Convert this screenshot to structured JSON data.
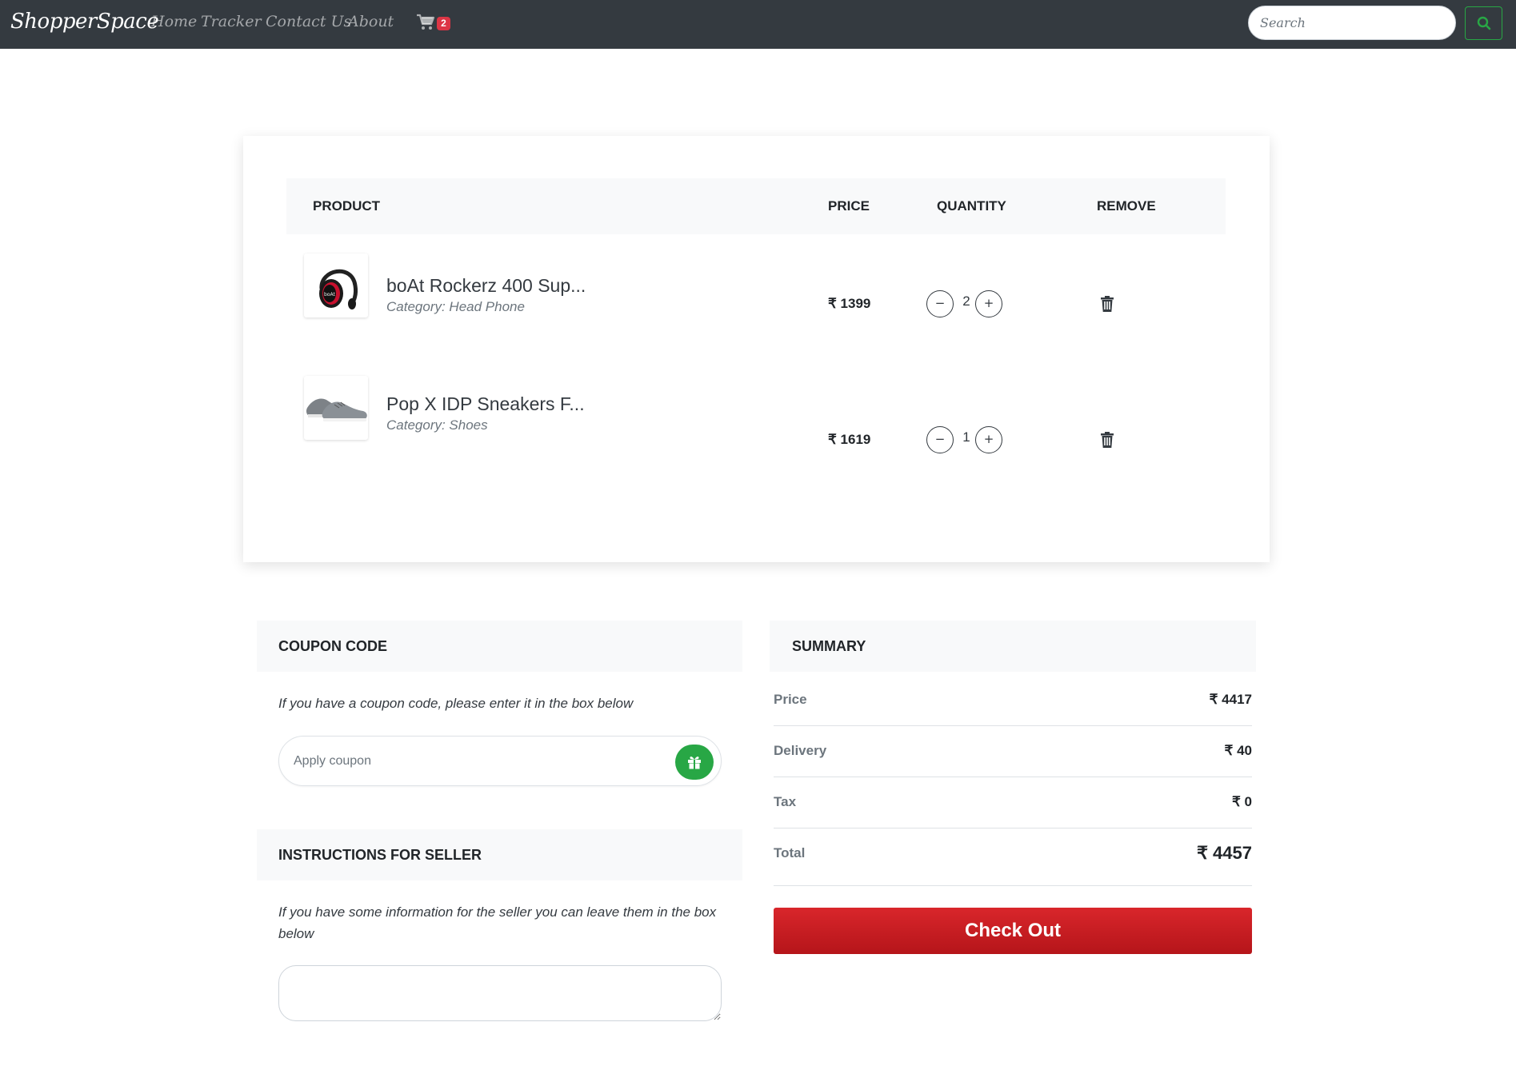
{
  "navbar": {
    "brand": "ShopperSpace",
    "links": [
      "Home",
      "Tracker",
      "Contact Us",
      "About"
    ],
    "cart_count": "2",
    "search_placeholder": "Search"
  },
  "cart": {
    "headers": {
      "product": "PRODUCT",
      "price": "PRICE",
      "quantity": "QUANTITY",
      "remove": "REMOVE"
    },
    "items": [
      {
        "name": "boAt Rockerz 400 Sup...",
        "category": "Category: Head Phone",
        "price": "₹ 1399",
        "quantity": "2",
        "image": "headphone-image"
      },
      {
        "name": "Pop X IDP Sneakers F...",
        "category": "Category: Shoes",
        "price": "₹ 1619",
        "quantity": "1",
        "image": "sneaker-image"
      }
    ],
    "minus_glyph": "−",
    "plus_glyph": "+"
  },
  "coupon": {
    "title": "COUPON CODE",
    "help": "If you have a coupon code, please enter it in the box below",
    "placeholder": "Apply coupon"
  },
  "instructions": {
    "title": "INSTRUCTIONS FOR SELLER",
    "help": "If you have some information for the seller you can leave them in the box below"
  },
  "summary": {
    "title": "SUMMARY",
    "rows": [
      {
        "label": "Price",
        "value": "₹ 4417"
      },
      {
        "label": "Delivery",
        "value": "₹ 40"
      },
      {
        "label": "Tax",
        "value": "₹ 0"
      },
      {
        "label": "Total",
        "value": "₹ 4457"
      }
    ],
    "checkout_label": "Check Out"
  },
  "colors": {
    "navbar": "#343a40",
    "accent_green": "#28a745",
    "badge_red": "#dc3545",
    "checkout_red": "#c81d22"
  },
  "icons": [
    "cart-icon",
    "search-icon",
    "trash-icon",
    "gift-icon"
  ]
}
